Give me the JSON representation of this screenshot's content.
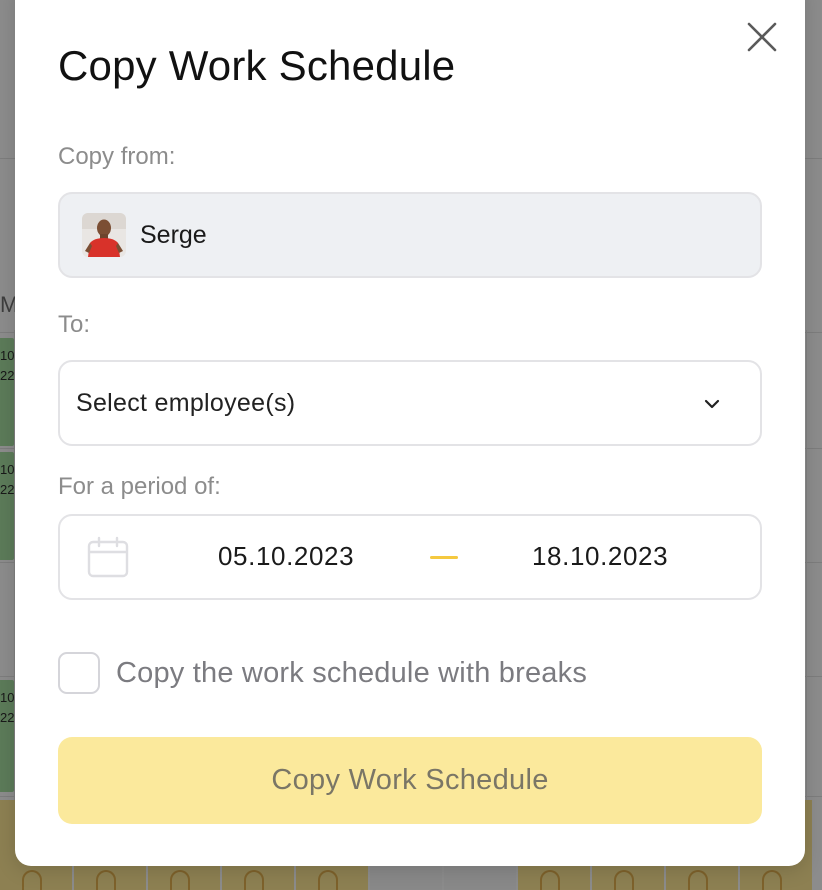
{
  "background": {
    "day_label": "M",
    "shift_blocks": [
      {
        "text": "10:\n22"
      },
      {
        "text": "10:\n22"
      },
      {
        "text": "10:\n22"
      }
    ]
  },
  "modal": {
    "title": "Copy Work Schedule",
    "close_icon": "close-icon",
    "copy_from": {
      "label": "Copy from:",
      "employee_name": "Serge"
    },
    "to": {
      "label": "To:",
      "placeholder": "Select employee(s)",
      "dropdown_icon": "chevron-down-icon"
    },
    "period": {
      "label": "For a period of:",
      "start_date": "05.10.2023",
      "end_date": "18.10.2023",
      "icon": "calendar-icon"
    },
    "breaks_option": {
      "label": "Copy the work schedule with breaks",
      "checked": false
    },
    "submit_label": "Copy Work Schedule"
  },
  "colors": {
    "accent_yellow": "#f5c93f",
    "button_disabled_bg": "#fbe99c",
    "button_disabled_text": "#7a7666",
    "shift_green": "#9fd49a",
    "cell_yellow": "#f3dd8d"
  }
}
